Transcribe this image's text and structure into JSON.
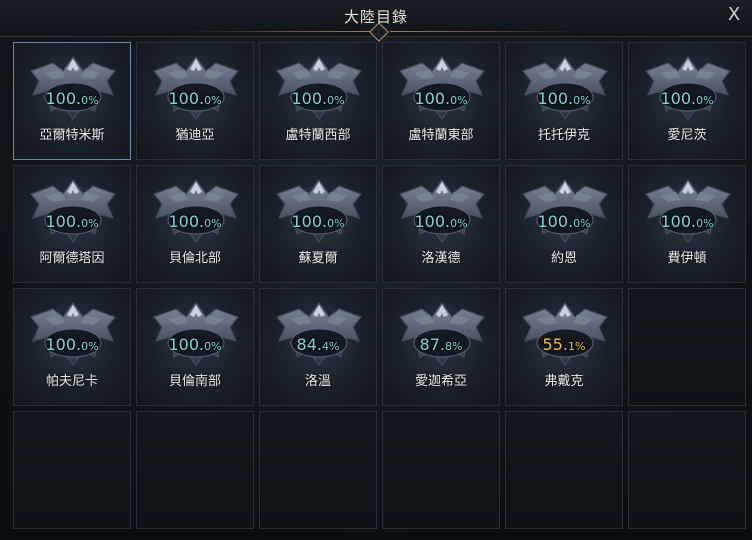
{
  "window": {
    "title": "大陸目錄",
    "close_label": "X"
  },
  "continents": [
    {
      "name": "亞爾特米斯",
      "pct_int": "100.",
      "pct_dec": "0%",
      "color": "#7fd6d2",
      "selected": true
    },
    {
      "name": "猶迪亞",
      "pct_int": "100.",
      "pct_dec": "0%",
      "color": "#7fd6d2"
    },
    {
      "name": "盧特蘭西部",
      "pct_int": "100.",
      "pct_dec": "0%",
      "color": "#7fd6d2"
    },
    {
      "name": "盧特蘭東部",
      "pct_int": "100.",
      "pct_dec": "0%",
      "color": "#7fd6d2"
    },
    {
      "name": "托托伊克",
      "pct_int": "100.",
      "pct_dec": "0%",
      "color": "#7fd6d2"
    },
    {
      "name": "愛尼茨",
      "pct_int": "100.",
      "pct_dec": "0%",
      "color": "#7fd6d2"
    },
    {
      "name": "阿爾德塔因",
      "pct_int": "100.",
      "pct_dec": "0%",
      "color": "#7fd6d2"
    },
    {
      "name": "貝倫北部",
      "pct_int": "100.",
      "pct_dec": "0%",
      "color": "#7fd6d2"
    },
    {
      "name": "蘇夏爾",
      "pct_int": "100.",
      "pct_dec": "0%",
      "color": "#7fd6d2"
    },
    {
      "name": "洛漢德",
      "pct_int": "100.",
      "pct_dec": "0%",
      "color": "#7fd6d2"
    },
    {
      "name": "約恩",
      "pct_int": "100.",
      "pct_dec": "0%",
      "color": "#7fd6d2"
    },
    {
      "name": "費伊頓",
      "pct_int": "100.",
      "pct_dec": "0%",
      "color": "#7fd6d2"
    },
    {
      "name": "帕夫尼卡",
      "pct_int": "100.",
      "pct_dec": "0%",
      "color": "#7fd6d2"
    },
    {
      "name": "貝倫南部",
      "pct_int": "100.",
      "pct_dec": "0%",
      "color": "#7fd6d2"
    },
    {
      "name": "洛溫",
      "pct_int": "84.",
      "pct_dec": "4%",
      "color": "#7fd6d2"
    },
    {
      "name": "愛迦希亞",
      "pct_int": "87.",
      "pct_dec": "8%",
      "color": "#7fd6d2"
    },
    {
      "name": "弗戴克",
      "pct_int": "55.",
      "pct_dec": "1%",
      "color": "#f0c24a"
    }
  ],
  "icons": {
    "emblem": "winged-crest-icon",
    "close": "close-icon"
  }
}
